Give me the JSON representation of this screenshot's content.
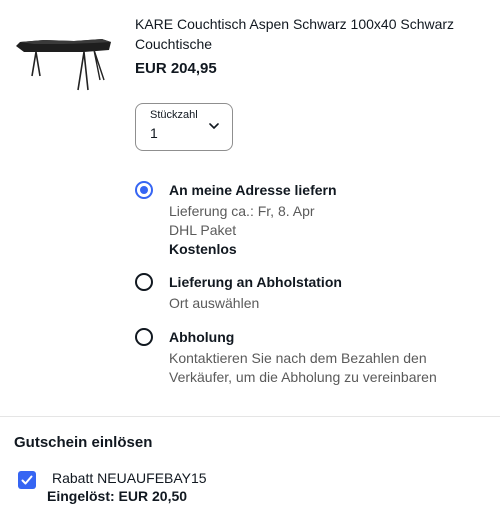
{
  "product": {
    "thumbnail_icon": "coffee-table-image",
    "title": "KARE Couchtisch Aspen Schwarz 100x40 Schwarz Couchtische",
    "price": "EUR 204,95"
  },
  "quantity": {
    "label": "Stückzahl",
    "value": "1",
    "chevron_icon": "chevron-down-icon"
  },
  "delivery_options": [
    {
      "title": "An meine Adresse liefern",
      "selected": true,
      "lines": [
        "Lieferung ca.: Fr, 8. Apr",
        "DHL Paket"
      ],
      "emphasis": "Kostenlos"
    },
    {
      "title": "Lieferung an Abholstation",
      "selected": false,
      "lines": [
        "Ort auswählen"
      ]
    },
    {
      "title": "Abholung",
      "selected": false,
      "lines": [
        "Kontaktieren Sie nach dem Bezahlen den",
        "Verkäufer, um die Abholung zu vereinbaren"
      ]
    }
  ],
  "coupon": {
    "heading": "Gutschein einlösen",
    "checked": true,
    "code_label": "Rabatt NEUAUFEBAY15",
    "applied_label": "Eingelöst: EUR 20,50"
  },
  "colors": {
    "accent": "#3665f3",
    "text": "#111820",
    "secondary_text": "#5a5a5a"
  }
}
